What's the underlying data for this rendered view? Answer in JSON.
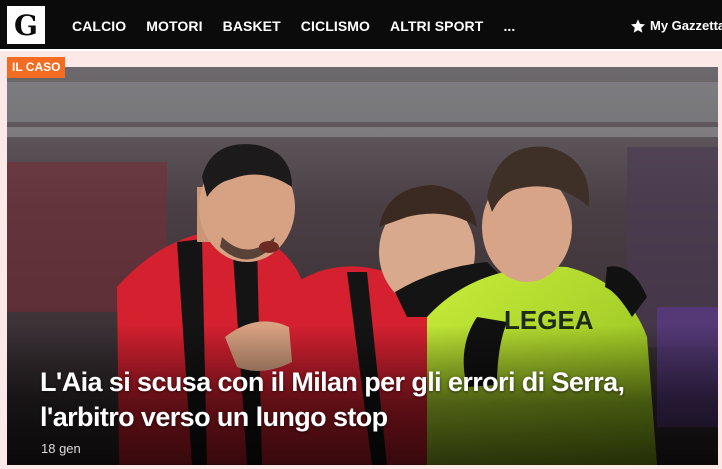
{
  "header": {
    "logo_letter": "G",
    "nav_items": [
      "CALCIO",
      "MOTORI",
      "BASKET",
      "CICLISMO",
      "ALTRI SPORT",
      "..."
    ],
    "my_gazzetta_label": "My Gazzetta"
  },
  "article": {
    "badge": "IL CASO",
    "headline_line1": "L'Aia si scusa con il Milan per gli errori di Serra,",
    "headline_line2": "l'arbitro verso un lungo stop",
    "date": "18 gen",
    "shirt_text": "LEGEA"
  },
  "colors": {
    "topbar": "#0b0b0b",
    "badge": "#f36c21",
    "milan_red": "#d4202f",
    "referee_shirt": "#b7e02a",
    "page_bg": "#fde8e8"
  },
  "icons": {
    "star": "star-icon"
  }
}
